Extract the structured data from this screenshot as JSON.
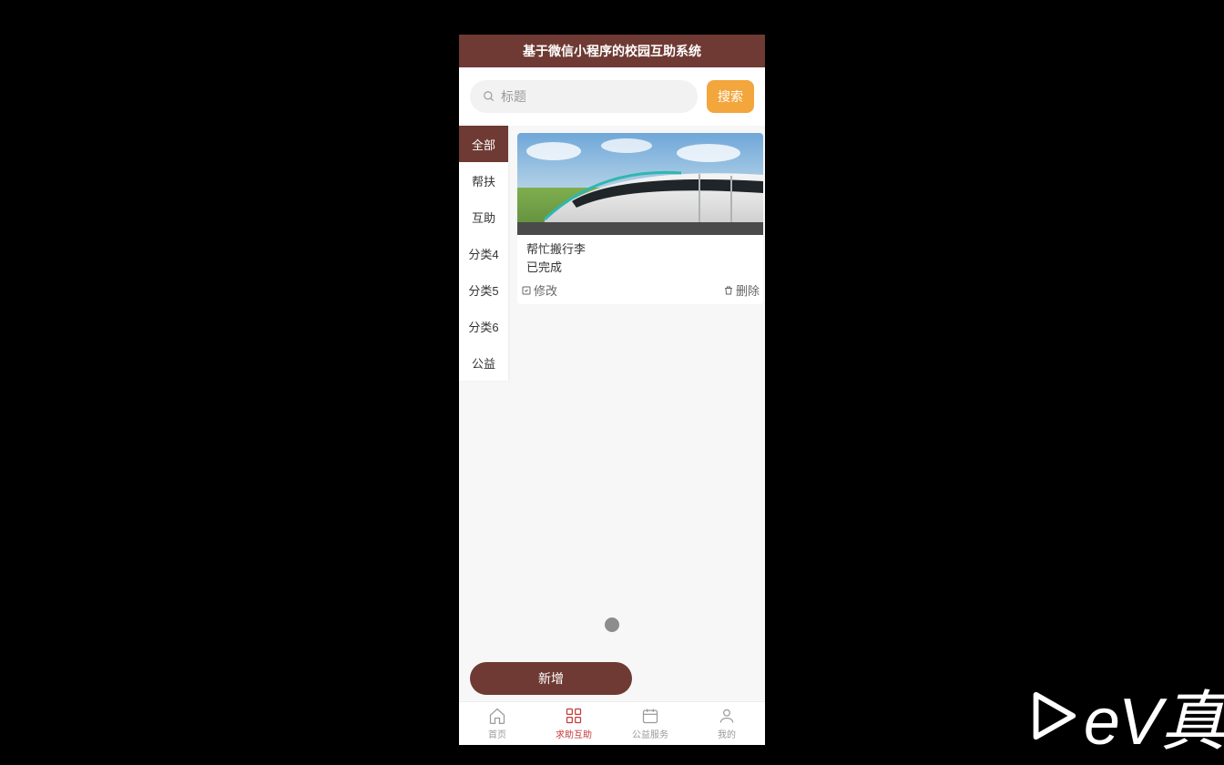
{
  "header": {
    "title": "基于微信小程序的校园互助系统"
  },
  "search": {
    "placeholder": "标题",
    "button": "搜索"
  },
  "sidebar": {
    "items": [
      {
        "label": "全部",
        "active": true
      },
      {
        "label": "帮扶"
      },
      {
        "label": "互助"
      },
      {
        "label": "分类4"
      },
      {
        "label": "分类5"
      },
      {
        "label": "分类6"
      },
      {
        "label": "公益"
      }
    ]
  },
  "card": {
    "title": "帮忙搬行李",
    "status": "已完成",
    "edit": "修改",
    "delete": "删除"
  },
  "addButton": "新增",
  "tabs": [
    {
      "label": "首页"
    },
    {
      "label": "求助互助",
      "active": true
    },
    {
      "label": "公益服务"
    },
    {
      "label": "我的"
    }
  ],
  "watermark": "eV真"
}
